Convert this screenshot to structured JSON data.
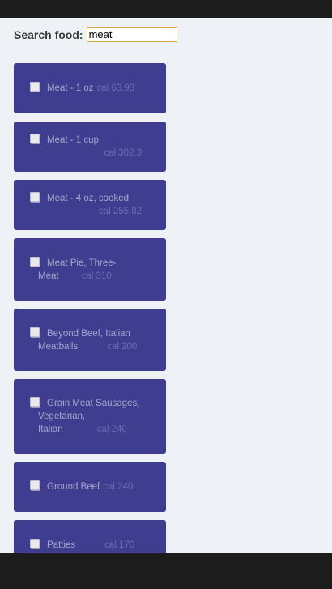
{
  "search": {
    "label": "Search food:",
    "value": "meat"
  },
  "foods": [
    {
      "name": "Meat - 1 oz",
      "cal": "cal 63.93"
    },
    {
      "name": "Meat - 1 cup",
      "cal": "cal 302.3"
    },
    {
      "name": "Meat - 4 oz, cooked",
      "cal": "cal 255.82"
    },
    {
      "name": "Meat Pie, Three-Meat",
      "cal": "cal 310"
    },
    {
      "name": "Beyond Beef, Italian Meatballs",
      "cal": "cal 200"
    },
    {
      "name": "Grain Meat Sausages, Vegetarian, Italian",
      "cal": "cal 240"
    },
    {
      "name": "Ground Beef",
      "cal": "cal 240"
    },
    {
      "name": "Patties",
      "cal": "cal 170"
    }
  ],
  "colors": {
    "card_bg": "#3f3d8f",
    "page_bg": "#eef1f6",
    "input_border": "#d9a43a"
  }
}
